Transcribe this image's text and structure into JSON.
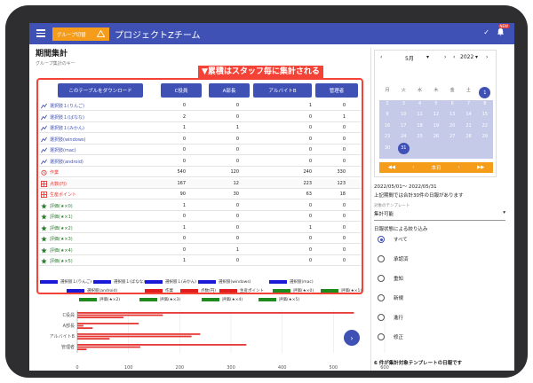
{
  "app": {
    "group_button": "グループ切替",
    "title": "プロジェクトZチーム",
    "badge": "NEW"
  },
  "page": {
    "title": "期間集計",
    "subtitle": "グループ集計のキー",
    "banner": "▼累積はスタッフ毎に集計される"
  },
  "table": {
    "download_button": "このテーブルをダウンロード",
    "columns": [
      "C役員",
      "A部長",
      "アルバイトB",
      "管理者"
    ],
    "rows": [
      {
        "label": "選択肢１(りんご)",
        "icon": "chart-icon",
        "values": [
          "0",
          "0",
          "1",
          "0"
        ]
      },
      {
        "label": "選択肢１(ばなな)",
        "icon": "chart-icon",
        "values": [
          "2",
          "0",
          "0",
          "1"
        ]
      },
      {
        "label": "選択肢１(みかん)",
        "icon": "chart-icon",
        "values": [
          "1",
          "1",
          "0",
          "0"
        ]
      },
      {
        "label": "選択肢(windows)",
        "icon": "chart-icon",
        "values": [
          "0",
          "0",
          "0",
          "0"
        ]
      },
      {
        "label": "選択肢(mac)",
        "icon": "chart-icon",
        "values": [
          "0",
          "0",
          "0",
          "0"
        ]
      },
      {
        "label": "選択肢(android)",
        "icon": "chart-icon",
        "values": [
          "0",
          "0",
          "0",
          "0"
        ]
      },
      {
        "label": "作業",
        "icon": "alarm-icon",
        "values": [
          "540",
          "120",
          "240",
          "330"
        ]
      },
      {
        "label": "点数(円)",
        "icon": "grid-icon",
        "values": [
          "167",
          "12",
          "223",
          "123"
        ]
      },
      {
        "label": "生産ポイント",
        "icon": "grid-icon",
        "values": [
          "90",
          "30",
          "63",
          "18"
        ]
      },
      {
        "label": "評価(★×0)",
        "icon": "star-icon",
        "values": [
          "1",
          "0",
          "0",
          "0"
        ]
      },
      {
        "label": "評価(★×1)",
        "icon": "star-icon",
        "values": [
          "0",
          "0",
          "0",
          "0"
        ]
      },
      {
        "label": "評価(★×2)",
        "icon": "star-icon",
        "values": [
          "1",
          "0",
          "1",
          "0"
        ]
      },
      {
        "label": "評価(★×3)",
        "icon": "star-icon",
        "values": [
          "0",
          "0",
          "0",
          "0"
        ]
      },
      {
        "label": "評価(★×4)",
        "icon": "star-icon",
        "values": [
          "0",
          "1",
          "0",
          "0"
        ]
      },
      {
        "label": "評価(★×5)",
        "icon": "star-icon",
        "values": [
          "1",
          "0",
          "0",
          "0"
        ]
      }
    ]
  },
  "legend": [
    {
      "label": "選択肢１(りんご)",
      "color": "#1a1ad6"
    },
    {
      "label": "選択肢１(ばなな)",
      "color": "#1a1ad6"
    },
    {
      "label": "選択肢１(みかん)",
      "color": "#1a1ad6"
    },
    {
      "label": "選択肢(windows)",
      "color": "#1a1ad6"
    },
    {
      "label": "選択肢(mac)",
      "color": "#1a1ad6"
    },
    {
      "label": "選択肢(android)",
      "color": "#1a1ad6"
    },
    {
      "label": "作業",
      "color": "#e01e1e"
    },
    {
      "label": "点数(円)",
      "color": "#e01e1e"
    },
    {
      "label": "生産ポイント",
      "color": "#e01e1e"
    },
    {
      "label": "評価(★×0)",
      "color": "#1e8a1e"
    },
    {
      "label": "評価(★×1)",
      "color": "#1e8a1e"
    },
    {
      "label": "評価(★×2)",
      "color": "#1e8a1e"
    },
    {
      "label": "評価(★×3)",
      "color": "#1e8a1e"
    },
    {
      "label": "評価(★×4)",
      "color": "#1e8a1e"
    },
    {
      "label": "評価(★×5)",
      "color": "#1e8a1e"
    }
  ],
  "chart_data": {
    "type": "bar",
    "orientation": "horizontal",
    "categories": [
      "C役員",
      "A部長",
      "アルバイトB",
      "管理者"
    ],
    "series": [
      {
        "name": "作業",
        "values": [
          540,
          120,
          240,
          330
        ]
      },
      {
        "name": "点数(円)",
        "values": [
          167,
          12,
          223,
          123
        ]
      },
      {
        "name": "生産ポイント",
        "values": [
          90,
          30,
          63,
          18
        ]
      }
    ],
    "xticks": [
      "0",
      "100",
      "200",
      "300",
      "400",
      "500",
      "600"
    ],
    "xlim": [
      0,
      600
    ]
  },
  "calendar": {
    "month": "5月",
    "year": "2022",
    "weekdays": [
      "月",
      "火",
      "水",
      "木",
      "金",
      "土",
      "日"
    ],
    "weeks": [
      [
        "",
        "",
        "",
        "",
        "",
        "",
        "1"
      ],
      [
        "2",
        "3",
        "4",
        "5",
        "6",
        "7",
        "8"
      ],
      [
        "9",
        "10",
        "11",
        "12",
        "13",
        "14",
        "15"
      ],
      [
        "16",
        "17",
        "18",
        "19",
        "20",
        "21",
        "22"
      ],
      [
        "23",
        "24",
        "25",
        "26",
        "27",
        "28",
        "29"
      ],
      [
        "30",
        "31",
        "",
        "",
        "",
        "",
        ""
      ]
    ],
    "today": "本日",
    "selected_start": "1",
    "selected_end": "31"
  },
  "side": {
    "range": "2022/05/01～ 2022/05/31",
    "note": "上記期間では合計30件の日報があります",
    "template_label": "対象のテンプレート",
    "template_value": "集計可能",
    "filter_title": "日報状態による絞り込み",
    "filters": [
      "すべて",
      "承認済",
      "重知",
      "新規",
      "進行",
      "修正"
    ],
    "selected_filter": "すべて",
    "summary": "6 件が集計対象テンプレートの日報です"
  }
}
